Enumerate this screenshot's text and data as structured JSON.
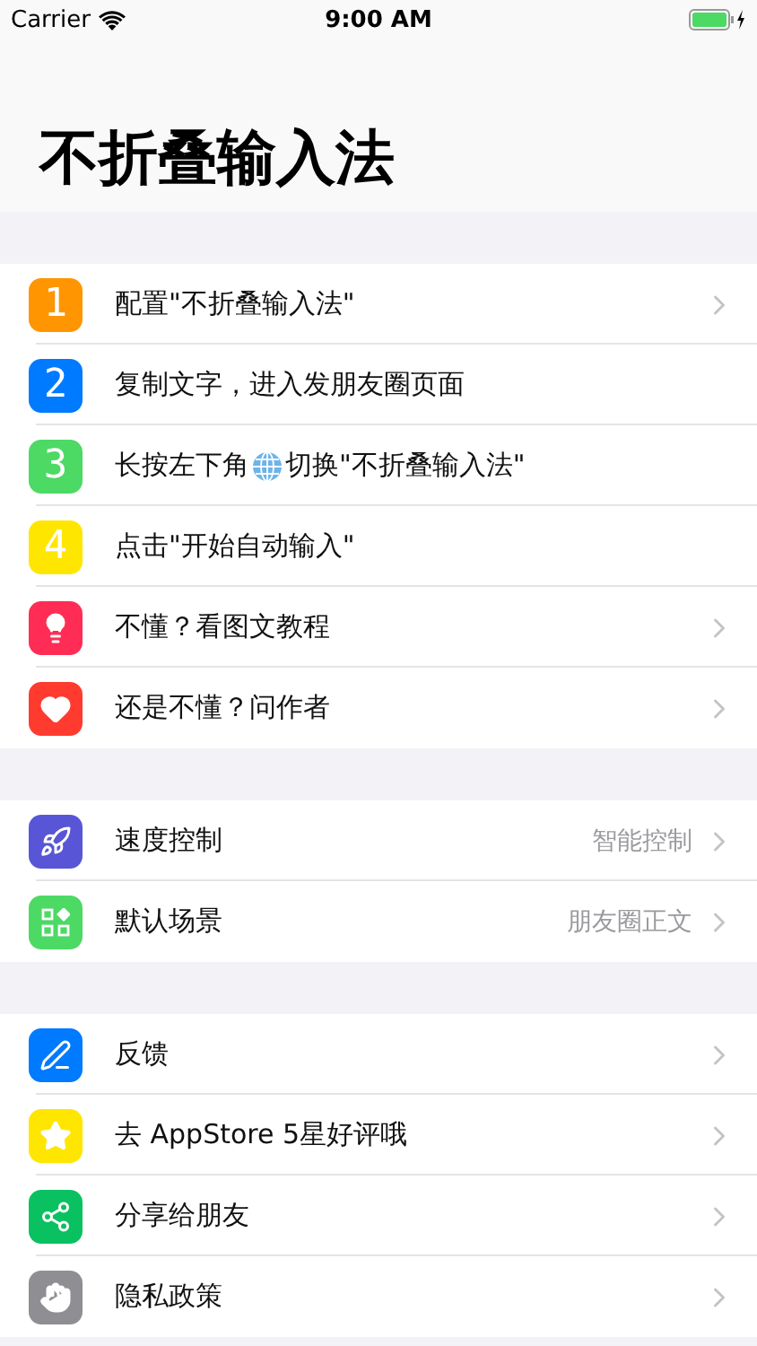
{
  "status_bar": {
    "carrier": "Carrier",
    "time": "9:00 AM"
  },
  "title": "不折叠输入法",
  "sections": [
    {
      "rows": [
        {
          "kind": "digit",
          "digit": "1",
          "color": "#ff9500",
          "label": "配置\"不折叠输入法\"",
          "chevron": true
        },
        {
          "kind": "digit",
          "digit": "2",
          "color": "#007aff",
          "label": "复制文字，进入发朋友圈页面",
          "chevron": false
        },
        {
          "kind": "digit",
          "digit": "3",
          "color": "#4cd964",
          "label": "长按左下角",
          "label_after_globe": "切换\"不折叠输入法\"",
          "chevron": false
        },
        {
          "kind": "digit",
          "digit": "4",
          "color": "#ffe600",
          "label": "点击\"开始自动输入\"",
          "chevron": false
        },
        {
          "kind": "bulb",
          "color": "#ff2d55",
          "label": "不懂？看图文教程",
          "chevron": true
        },
        {
          "kind": "heart",
          "color": "#ff3b30",
          "label": "还是不懂？问作者",
          "chevron": true
        }
      ]
    },
    {
      "rows": [
        {
          "kind": "rocket",
          "color": "#5856d6",
          "label": "速度控制",
          "value": "智能控制",
          "chevron": true
        },
        {
          "kind": "apps",
          "color": "#4cd964",
          "label": "默认场景",
          "value": "朋友圈正文",
          "chevron": true
        }
      ]
    },
    {
      "rows": [
        {
          "kind": "pen",
          "color": "#007aff",
          "label": "反馈",
          "chevron": true
        },
        {
          "kind": "star",
          "color": "#ffe600",
          "label": "去 AppStore 5星好评哦",
          "chevron": true
        },
        {
          "kind": "share",
          "color": "#09c160",
          "label": "分享给朋友",
          "chevron": true
        },
        {
          "kind": "hand",
          "color": "#8e8e93",
          "label": "隐私政策",
          "chevron": true
        }
      ]
    }
  ]
}
